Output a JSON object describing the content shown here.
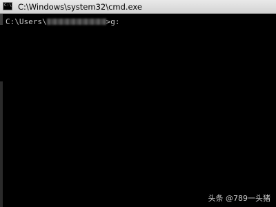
{
  "window": {
    "title": "C:\\Windows\\system32\\cmd.exe",
    "icon": "cmd-window-icon",
    "icon_text": "C:\\"
  },
  "console": {
    "prompt_prefix": "C:\\Users\\",
    "prompt_suffix": ">g:"
  },
  "watermark": {
    "text": "头条 @789一头猪"
  },
  "colors": {
    "background": "#000000",
    "text": "#c8c8c8",
    "titlebar": "#dcdcdc"
  }
}
